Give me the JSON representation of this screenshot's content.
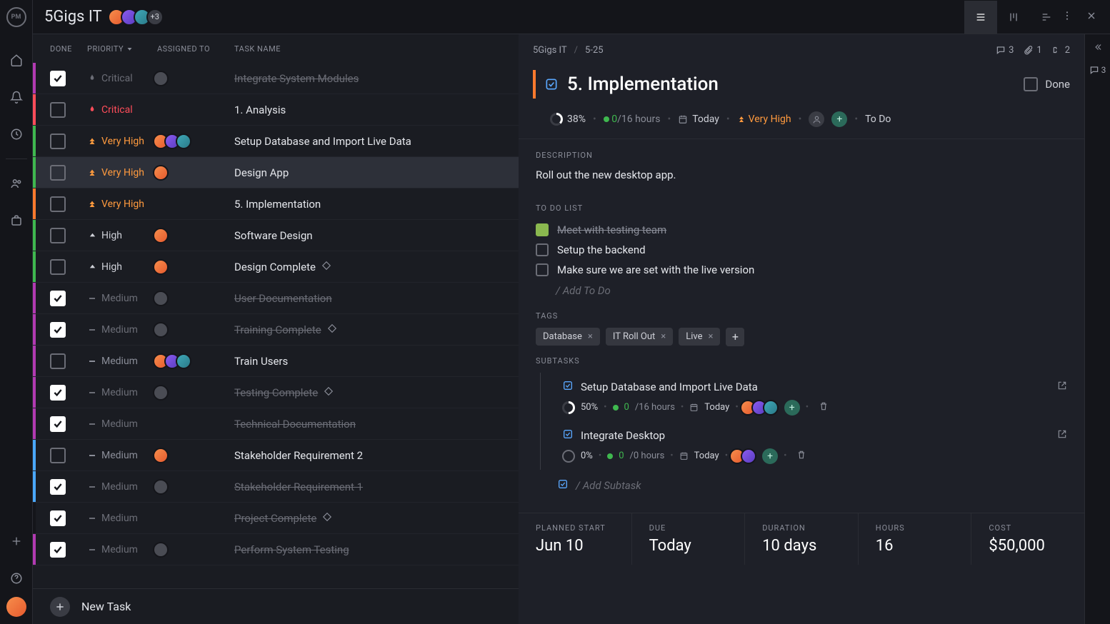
{
  "project": {
    "name": "5Gigs IT",
    "extraMembers": "+3"
  },
  "views": {
    "list": true,
    "board": false,
    "gantt": false
  },
  "columns": {
    "done": "DONE",
    "priority": "PRIORITY",
    "assigned": "ASSIGNED TO",
    "taskname": "TASK NAME"
  },
  "priorities": {
    "critical": {
      "label": "Critical",
      "color": "#ff4d5a"
    },
    "veryhigh": {
      "label": "Very High",
      "color": "#ff9a3e"
    },
    "high": {
      "label": "High",
      "color": "#cfd1d8"
    },
    "medium": {
      "label": "Medium",
      "color": "#8a8d98"
    }
  },
  "tasks": [
    {
      "color": "#b23ab2",
      "done": true,
      "priority": "critical",
      "name": "Integrate System Modules",
      "avatars": [
        "grey"
      ]
    },
    {
      "color": "#ff4d5a",
      "done": false,
      "priority": "critical",
      "name": "1. Analysis",
      "avatars": []
    },
    {
      "color": "#3fb84f",
      "done": false,
      "priority": "veryhigh",
      "name": "Setup Database and Import Live Data",
      "avatars": [
        "a",
        "b",
        "c"
      ]
    },
    {
      "color": "#3fb84f",
      "done": false,
      "priority": "veryhigh",
      "name": "Design App",
      "avatars": [
        "a"
      ],
      "selected": true
    },
    {
      "color": "#ff7a2e",
      "done": false,
      "priority": "veryhigh",
      "name": "5. Implementation",
      "avatars": []
    },
    {
      "color": "#3fb84f",
      "done": false,
      "priority": "high",
      "name": "Software Design",
      "avatars": [
        "a"
      ]
    },
    {
      "color": "#3fb84f",
      "done": false,
      "priority": "high",
      "name": "Design Complete",
      "avatars": [
        "a"
      ],
      "milestone": true
    },
    {
      "color": "#b23ab2",
      "done": true,
      "priority": "medium",
      "name": "User Documentation",
      "avatars": [
        "grey"
      ]
    },
    {
      "color": "#b23ab2",
      "done": true,
      "priority": "medium",
      "name": "Training Complete",
      "avatars": [
        "grey"
      ],
      "milestone": true
    },
    {
      "color": "#b23ab2",
      "done": false,
      "priority": "medium",
      "name": "Train Users",
      "avatars": [
        "a",
        "b",
        "c"
      ]
    },
    {
      "color": "#b23ab2",
      "done": true,
      "priority": "medium",
      "name": "Testing Complete",
      "avatars": [
        "grey"
      ],
      "milestone": true
    },
    {
      "color": "#b23ab2",
      "done": true,
      "priority": "medium",
      "name": "Technical Documentation",
      "avatars": []
    },
    {
      "color": "#4aa8ff",
      "done": false,
      "priority": "medium",
      "name": "Stakeholder Requirement 2",
      "avatars": [
        "a"
      ]
    },
    {
      "color": "#4aa8ff",
      "done": true,
      "priority": "medium",
      "name": "Stakeholder Requirement 1",
      "avatars": [
        "grey"
      ]
    },
    {
      "color": "#14151a",
      "done": true,
      "priority": "medium",
      "name": "Project Complete",
      "avatars": [],
      "milestone": true
    },
    {
      "color": "#b23ab2",
      "done": true,
      "priority": "medium",
      "name": "Perform System Testing",
      "avatars": [
        "grey"
      ]
    }
  ],
  "newTask": "New Task",
  "detail": {
    "breadcrumb": {
      "project": "5Gigs IT",
      "range": "5-25"
    },
    "counts": {
      "comments": "3",
      "attachments": "1",
      "subtasks": "2"
    },
    "title": "5. Implementation",
    "doneLabel": "Done",
    "meta": {
      "percent": "38%",
      "hoursLogged": "0",
      "hoursTotal": "/16 hours",
      "date": "Today",
      "priority": "Very High",
      "status": "To Do"
    },
    "descriptionLabel": "DESCRIPTION",
    "description": "Roll out the new desktop app.",
    "todoLabel": "TO DO LIST",
    "todos": [
      {
        "done": true,
        "text": "Meet with testing team"
      },
      {
        "done": false,
        "text": "Setup the backend"
      },
      {
        "done": false,
        "text": "Make sure we are set with the live version"
      }
    ],
    "addTodo": "/ Add To Do",
    "tagsLabel": "TAGS",
    "tags": [
      "Database",
      "IT Roll Out",
      "Live"
    ],
    "subtasksLabel": "SUBTASKS",
    "subtasks": [
      {
        "title": "Setup Database and Import Live Data",
        "percent": "50%",
        "hoursLogged": "0",
        "hoursTotal": "/16 hours",
        "date": "Today",
        "avatars": [
          "a",
          "b",
          "c"
        ]
      },
      {
        "title": "Integrate Desktop",
        "percent": "0%",
        "hoursLogged": "0",
        "hoursTotal": "/0 hours",
        "date": "Today",
        "avatars": [
          "a",
          "b"
        ]
      }
    ],
    "addSubtask": "/ Add Subtask",
    "stats": {
      "plannedStartLabel": "PLANNED START",
      "plannedStart": "Jun 10",
      "dueLabel": "DUE",
      "due": "Today",
      "durationLabel": "DURATION",
      "duration": "10 days",
      "hoursLabel": "HOURS",
      "hours": "16",
      "costLabel": "COST",
      "cost": "$50,000"
    }
  },
  "rightRail": {
    "comments": "3"
  },
  "avatarColors": {
    "a": "linear-gradient(135deg,#f78e4c,#e65a2e)",
    "b": "linear-gradient(135deg,#8a5cf0,#5a3cc0)",
    "c": "linear-gradient(135deg,#3fa8b8,#2a7a88)",
    "grey": "#4a4c54"
  }
}
